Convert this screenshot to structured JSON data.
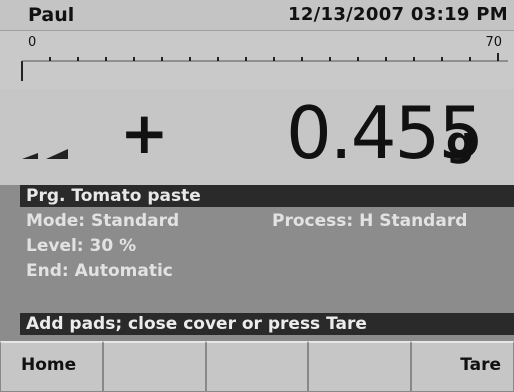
{
  "topbar": {
    "user": "Paul",
    "datetime": "12/13/2007 03:19 PM"
  },
  "scale": {
    "min_label": "0",
    "max_label": "70"
  },
  "display": {
    "sign": "+",
    "weight": "0.455",
    "unit": "g",
    "stability_icon": "stable-indicator-icon"
  },
  "program": {
    "label": "Prg. Tomato paste"
  },
  "details": {
    "mode": "Mode: Standard",
    "process": "Process: H Standard",
    "level": "Level:  30 %",
    "end": "End: Automatic"
  },
  "message": "Add pads; close cover or press Tare",
  "softkeys": [
    "Home",
    "",
    "",
    "",
    "Tare"
  ],
  "colors": {
    "dark_bar": "#2a2a2a",
    "panel": "#8c8c8c",
    "display_bg": "#c6c6c6"
  }
}
